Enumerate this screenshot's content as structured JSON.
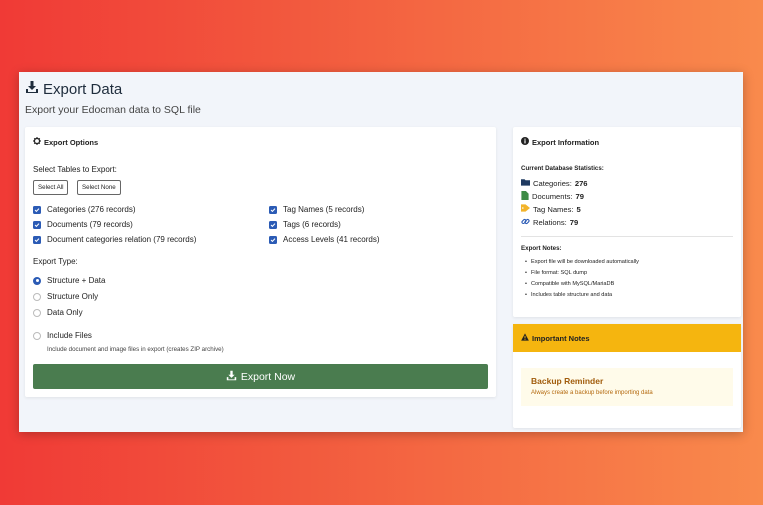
{
  "page": {
    "title": "Export Data",
    "subtitle": "Export your Edocman data to SQL file"
  },
  "export_options": {
    "header": "Export Options",
    "select_tables_label": "Select Tables to Export:",
    "select_all_label": "Select All",
    "select_none_label": "Select None",
    "tables": [
      {
        "label": "Categories (276 records)",
        "checked": true
      },
      {
        "label": "Documents (79 records)",
        "checked": true
      },
      {
        "label": "Document categories relation (79 records)",
        "checked": true
      },
      {
        "label": "Tag Names (5 records)",
        "checked": true
      },
      {
        "label": "Tags (6 records)",
        "checked": true
      },
      {
        "label": "Access Levels (41 records)",
        "checked": true
      }
    ],
    "export_type_label": "Export Type:",
    "export_types": [
      {
        "label": "Structure + Data",
        "selected": true
      },
      {
        "label": "Structure Only",
        "selected": false
      },
      {
        "label": "Data Only",
        "selected": false
      }
    ],
    "include_files_label": "Include Files",
    "include_files_checked": false,
    "include_files_help": "Include document and image files in export (creates ZIP archive)",
    "export_button_label": "Export Now"
  },
  "export_info": {
    "header": "Export Information",
    "stats_title": "Current Database Statistics:",
    "stats": [
      {
        "icon": "folder-icon",
        "label": "Categories:",
        "value": "276"
      },
      {
        "icon": "file-icon",
        "label": "Documents:",
        "value": "79"
      },
      {
        "icon": "tag-icon",
        "label": "Tag Names:",
        "value": "5"
      },
      {
        "icon": "link-icon",
        "label": "Relations:",
        "value": "79"
      }
    ],
    "notes_title": "Export Notes:",
    "notes": [
      "Export file will be downloaded automatically",
      "File format: SQL dump",
      "Compatible with MySQL/MariaDB",
      "Includes table structure and data"
    ]
  },
  "important": {
    "header": "Important Notes",
    "reminder_title": "Backup Reminder",
    "reminder_text": "Always create a backup before importing data"
  },
  "colors": {
    "accent_blue": "#2b5bb5",
    "export_button": "#4a7c4f",
    "warning_header": "#f5b50f",
    "reminder_text": "#a15c0c"
  }
}
